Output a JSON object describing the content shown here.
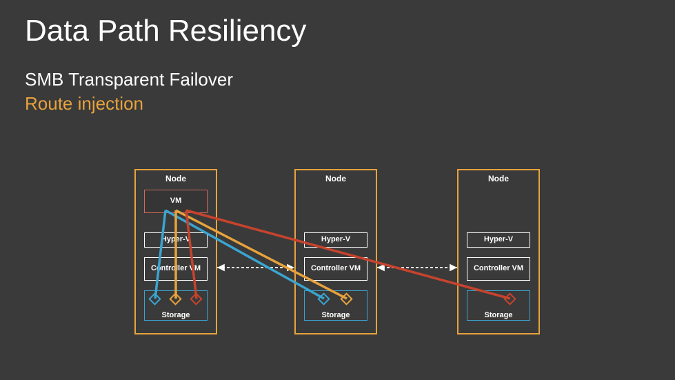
{
  "title": "Data Path Resiliency",
  "subtitle1": "SMB Transparent Failover",
  "subtitle2": "Route injection",
  "node_label": "Node",
  "vm_label": "VM",
  "hyperv_label": "Hyper-V",
  "controller_label": "Controller VM",
  "storage_label": "Storage",
  "colors": {
    "blue": "#3aa5d0",
    "yellow": "#e8a33c",
    "red": "#c7432d"
  }
}
